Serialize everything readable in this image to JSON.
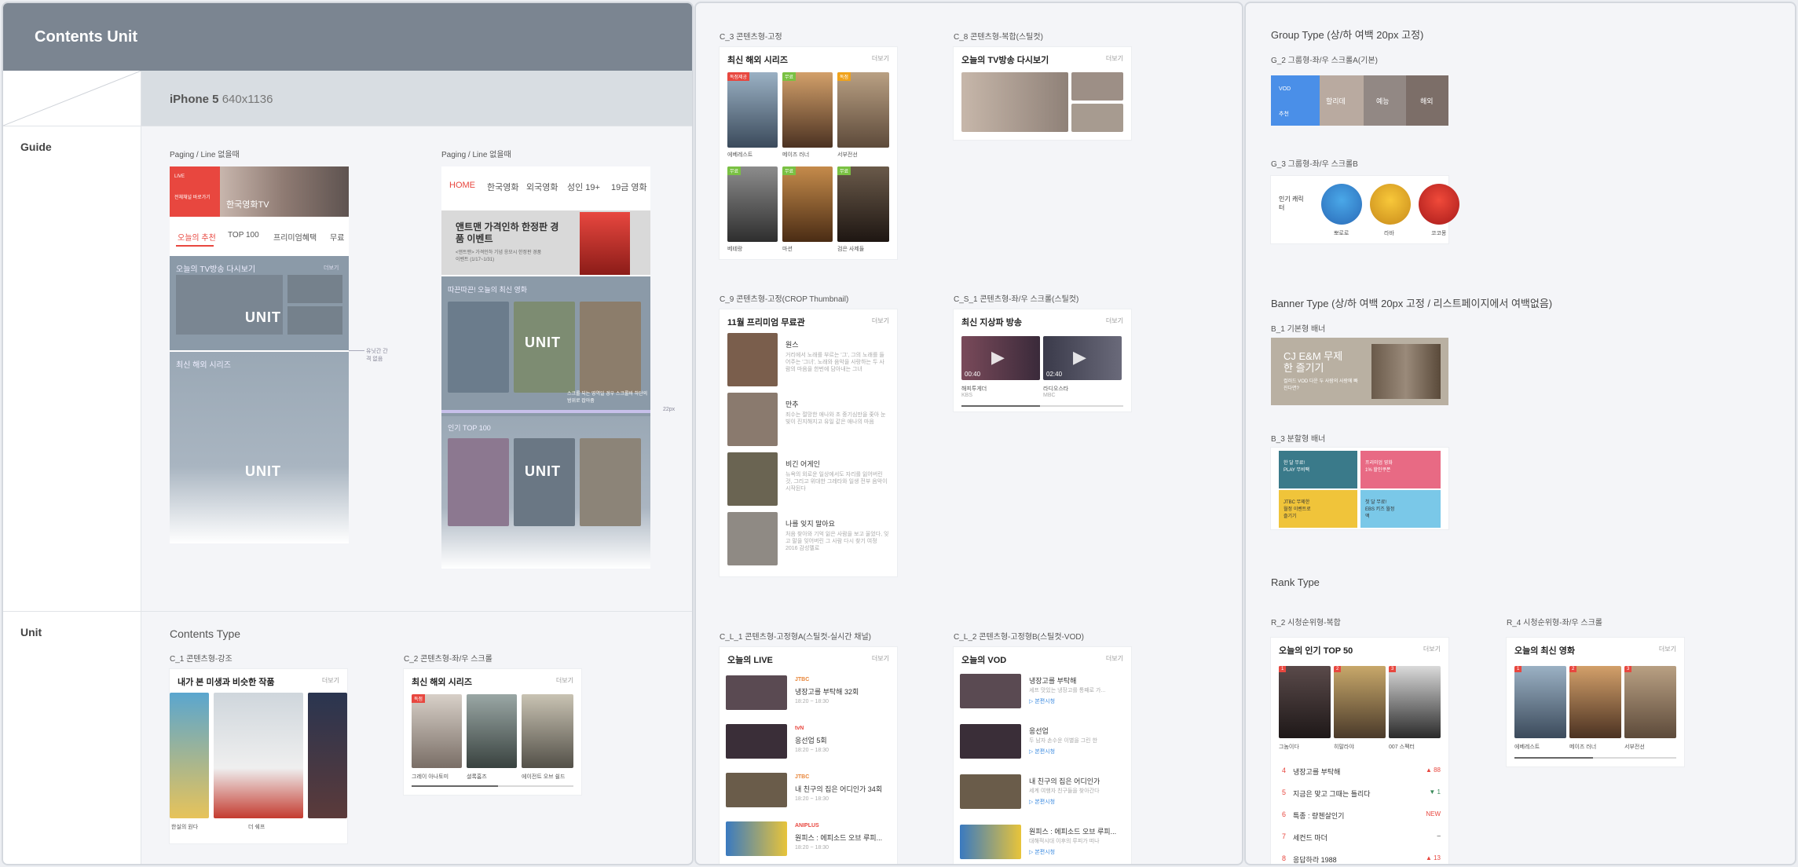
{
  "header": {
    "title": "Contents Unit",
    "device": "iPhone 5",
    "device_res": "640x1136"
  },
  "side": {
    "guide": "Guide",
    "unit": "Unit"
  },
  "guide": {
    "left_label": "Paging / Line 없을때",
    "right_label": "Paging / Line 없을때",
    "left_tabs": [
      "오늘의 추천",
      "TOP 100",
      "프리미엄혜택",
      "무료"
    ],
    "live_badge": "LIVE",
    "live_text": "전체채널 바로가기",
    "live_title": "한국영화TV",
    "tv_title": "오늘의 TV방송 다시보기",
    "more": "더보기",
    "series_title": "최신 해외 시리즈",
    "unit_word": "UNIT",
    "ann_side": "유닛간 간격 없음",
    "ann_22": "22px",
    "right_tabs": [
      "HOME",
      "한국영화",
      "외국영화",
      "성인 19+",
      "19금 영화"
    ],
    "banner_title": "앤트맨 가격인하 한정판 경품 이벤트",
    "banner_sub": "<앤트맨> 가격인하 기념 응모시 한정판 경품 이벤트 (1/17~1/31)",
    "latest_title": "따끈따끈! 오늘의 최신 영화",
    "top_title": "인기 TOP 100",
    "overlay_note": "스크롤 되는 영역일 경우 스크롤바 하단의 범위로 잡아줌"
  },
  "unit_section": {
    "title": "Contents Type",
    "c1_label": "C_1 콘텐츠형-강조",
    "c1_title": "내가 본 미생과 비슷한 작품",
    "c1_caps": [
      "한실의 원다",
      "더 쉐프",
      ""
    ],
    "c2_label": "C_2 콘텐츠형-좌/우 스크롤",
    "c2_title": "최신 해외 시리즈",
    "c2_caps": [
      "그레이 아나토미",
      "셜록홈즈",
      "에이전트 오브 쉴드"
    ]
  },
  "mid": {
    "c3_label": "C_3 콘텐츠형-고정",
    "c3_title": "최신 해외 시리즈",
    "c3_caps": [
      "에베레스트",
      "메이즈 러너",
      "서부전선",
      "베테랑",
      "마션",
      "검은 사제들"
    ],
    "c3_tags": [
      "독점제공",
      "무료",
      "",
      "무료",
      "무료",
      "무료"
    ],
    "c8_label": "C_8 콘텐츠형-복합(스틸컷)",
    "c8_title": "오늘의 TV방송 다시보기",
    "c9_label": "C_9 콘텐츠형-고정(CROP Thumbnail)",
    "c9_title": "11월 프리미엄 무료관",
    "c9_items": [
      {
        "title": "원스",
        "desc": "거리에서 노래를 부르는 '그', 그의 노래를 들어주는 '그녀', 노래와 음악을 사랑하는 두 사람의 마음을 한번에 담아내는 그녀"
      },
      {
        "title": "만추",
        "desc": "죄수는 절망한 애나와 초 중기심만을 좇아 눈빛이 진지해지고 유일 같은 애나의 마음"
      },
      {
        "title": "비긴 어게인",
        "desc": "뉴욕의 외로운 일상에서도 자리를 잃어버린 것, 그리고 위대한 그레타와 일생 전부 음악이 시작된다"
      },
      {
        "title": "나를 잊지 말아요",
        "desc": "처음 찾아와 기억 잃은 사람을 보고 울었다, 잊고 말을 잊어버린 그 사람 다시 찾기 여정 2016 감성멜로"
      }
    ],
    "cs1_label": "C_S_1 콘텐츠형-좌/우 스크롤(스틸컷)",
    "cs1_title": "최신 지상파 방송",
    "cs1_caps": [
      "해피투게더",
      "라디오스타"
    ],
    "cs1_subs": [
      "KBS",
      "MBC"
    ],
    "cs1_times": [
      "00:40",
      "02:40"
    ],
    "cl1_label": "C_L_1 콘텐츠형-고정형A(스틸컷-실시간 채널)",
    "cl1_title": "오늘의 LIVE",
    "cl1_items": [
      {
        "ch": "JTBC",
        "title": "냉장고를 부탁해 32회",
        "time": "18:20 ~ 18:30"
      },
      {
        "ch": "tvN",
        "title": "응선업 5회",
        "time": "18:20 ~ 18:30"
      },
      {
        "ch": "JTBC",
        "title": "내 친구의 집은 어디인가 34회",
        "time": "18:20 ~ 18:30"
      },
      {
        "ch": "ANIPLUS",
        "title": "원피스 : 에피소드 오브 루피...",
        "time": "18:20 ~ 18:30"
      }
    ],
    "cl2_label": "C_L_2 콘텐츠형-고정형B(스틸컷-VOD)",
    "cl2_title": "오늘의 VOD",
    "cl2_items": [
      {
        "title": "냉장고를 부탁해",
        "desc": "셰프 맛있는 냉장고를 통째로 가..."
      },
      {
        "title": "응선업",
        "desc": "두 남자 손수운 이별을 그린 한"
      },
      {
        "title": "내 친구의 집은 어디인가",
        "desc": "세계 여행자 친구들을 찾아간다"
      },
      {
        "title": "원피스 : 에피소드 오브 루피...",
        "desc": "대해적시대 이후의 루피가 떠나"
      }
    ],
    "cl2_link": "▷ 본편시청"
  },
  "right": {
    "group_title": "Group Type (상/하 여백 20px 고정)",
    "g2_label": "G_2 그룹형-좌/우 스크롤A(기본)",
    "g2_items": [
      "VOD",
      "추천"
    ],
    "g2_caps": [
      "할리데",
      "예능",
      "해외"
    ],
    "g3_label": "G_3 그룹형-좌/우 스크롤B",
    "g3_title": "인기 캐릭터",
    "g3_caps": [
      "뽀로로",
      "라바",
      "코코몽"
    ],
    "banner_title": "Banner Type (상/하 여백 20px 고정 / 리스트페이지에서 여백없음)",
    "b1_label": "B_1 기본형 배너",
    "b1_title": "CJ E&M 무제한 즐기기",
    "b1_sub": "컬러드 VOD 다운 두 사람의 사랑에 빠진다면?",
    "b3_label": "B_3 분할형 배너",
    "b3_items": [
      "한 달 무료! PLAY 무비팩",
      "프리미엄 영화 1% 할인쿠폰",
      "JTBC 무제한 월정 이벤트로 즐기기",
      "첫 달 무료! EBS 키즈 월정액"
    ],
    "rank_title": "Rank Type",
    "r2_label": "R_2 시청순위형-복합",
    "r2_title": "오늘의 인기 TOP 50",
    "r2_caps": [
      "그놈이다",
      "히말라야",
      "007 스펙터"
    ],
    "r2_rows": [
      {
        "n": "4",
        "t": "냉장고를 부탁해",
        "c": "▲ 88"
      },
      {
        "n": "5",
        "t": "지금은 맞고 그때는 틀리다",
        "c": "▼ 1"
      },
      {
        "n": "6",
        "t": "특종 : 량첸살인기",
        "c": "NEW"
      },
      {
        "n": "7",
        "t": "세컨드 마더",
        "c": "–"
      },
      {
        "n": "8",
        "t": "응답하라 1988",
        "c": "▲ 13"
      }
    ],
    "r4_label": "R_4 시청순위형-좌/우 스크롤",
    "r4_title": "오늘의 최신 영화",
    "r4_caps": [
      "에베레스트",
      "메이즈 러너",
      "서부전선"
    ]
  },
  "colors": {
    "accent": "#e8473f",
    "header": "#7b8591",
    "guide_bg": "#d8dde2",
    "panel_bg": "#f4f5f8"
  }
}
